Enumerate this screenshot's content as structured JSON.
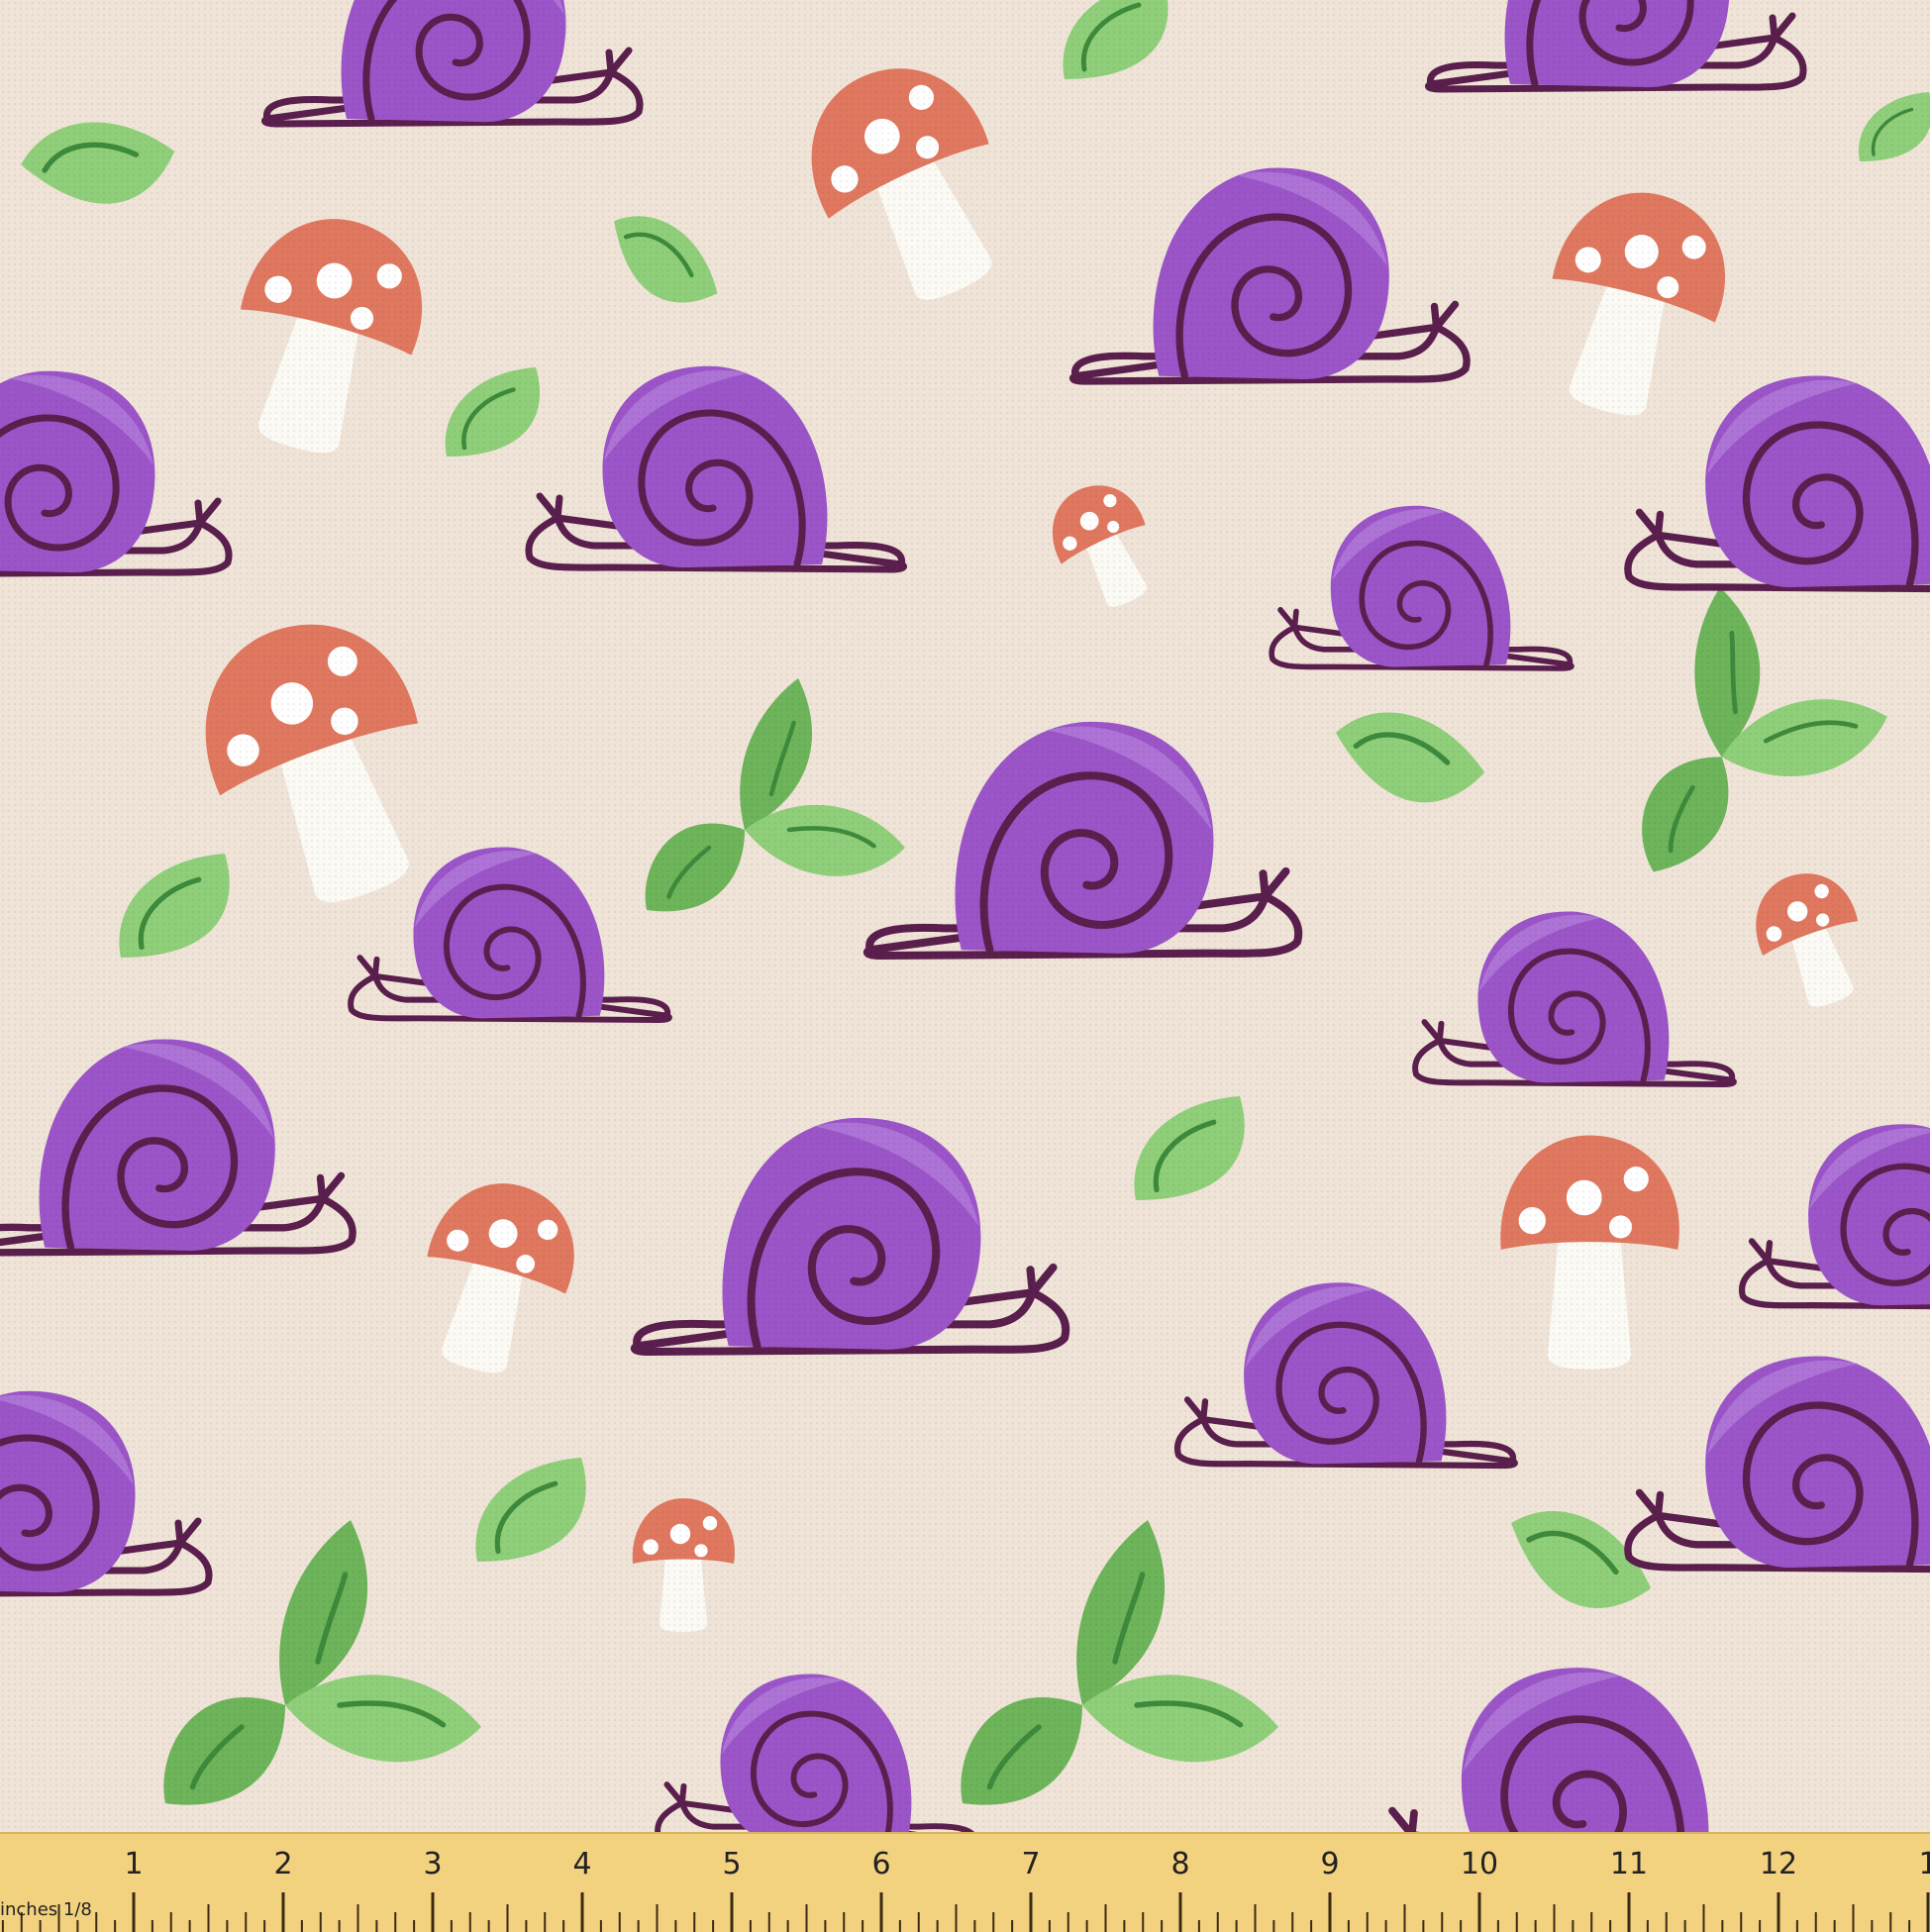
{
  "fabric": {
    "background": "#f0e4d8",
    "colors": {
      "snail_shell": "#9b55c8",
      "snail_shell_highlight": "#b27ad9",
      "snail_outline": "#5a1f4d",
      "mushroom_cap": "#e07860",
      "mushroom_spot": "#ffffff",
      "mushroom_stem": "#fbfaf5",
      "leaf_light": "#8fcf7a",
      "leaf_dark": "#6db45a",
      "leaf_vein": "#3e8a3c"
    },
    "motifs": [
      "snail",
      "mushroom",
      "leaf"
    ]
  },
  "ruler": {
    "unit_label": "inches 1/8",
    "numbers": [
      "1",
      "2",
      "3",
      "4",
      "5",
      "6",
      "7",
      "8",
      "9",
      "10",
      "11",
      "12",
      "1"
    ],
    "color": "#f3d27f"
  }
}
